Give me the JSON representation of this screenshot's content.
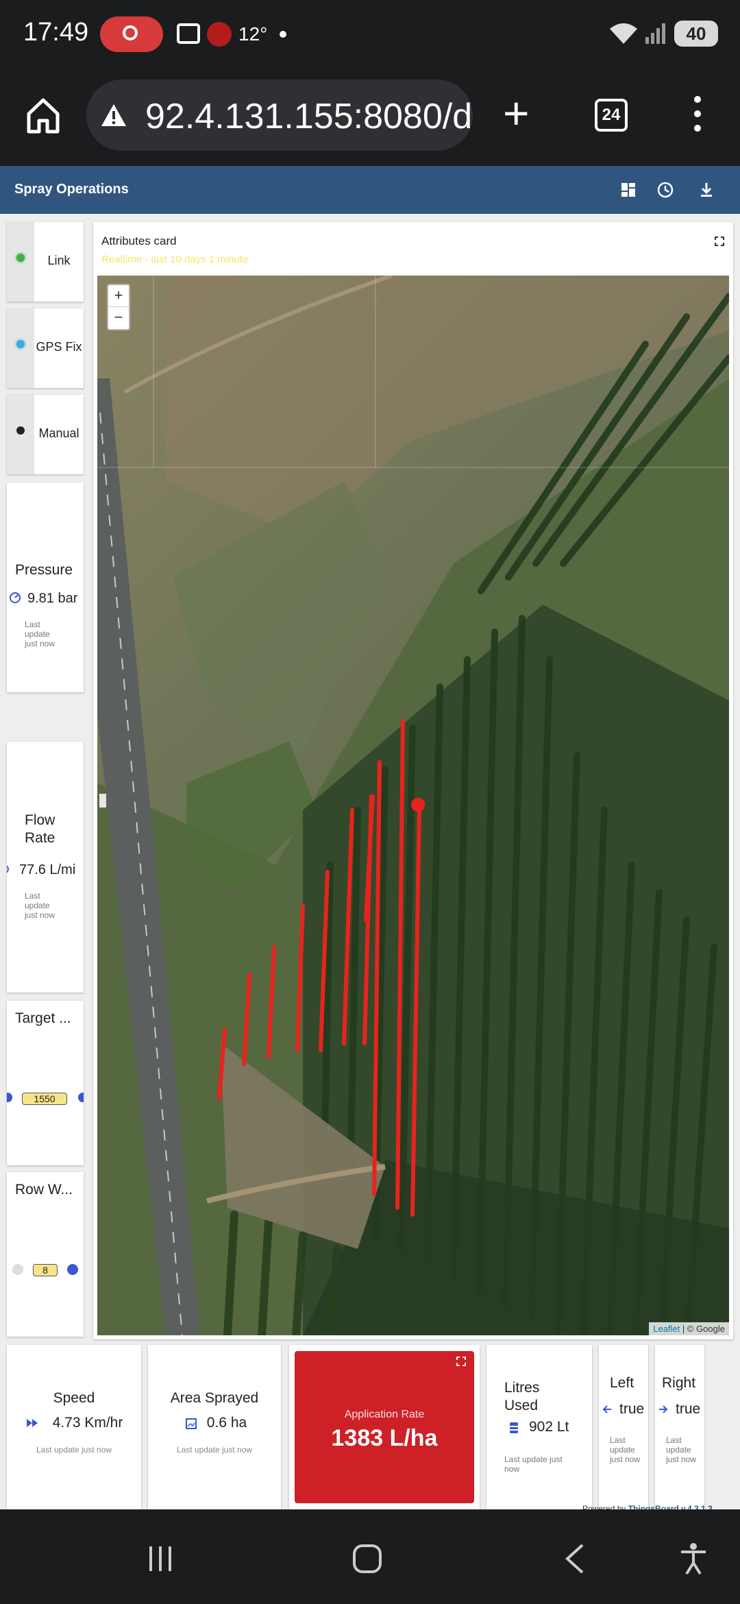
{
  "status_bar": {
    "time": "17:49",
    "temperature": "12°",
    "battery": "40",
    "icons": [
      "screen-record-icon",
      "camera-icon",
      "app-notification-icon",
      "wifi-icon",
      "signal-icon",
      "battery-icon"
    ]
  },
  "browser": {
    "url": "92.4.131.155:8080/d",
    "tab_count": "24",
    "icons": [
      "home-icon",
      "warning-icon",
      "new-tab-icon",
      "tabs-icon",
      "more-icon"
    ]
  },
  "dashboard": {
    "title": "Spray Operations",
    "toolbar_icons": [
      "layout-icon",
      "history-icon",
      "download-icon"
    ]
  },
  "indicators": [
    {
      "label": "Link",
      "led_color": "#3fb14a"
    },
    {
      "label": "GPS Fix",
      "led_color": "#3fa9df"
    },
    {
      "label": "Manual",
      "led_color": "#222222"
    }
  ],
  "pressure": {
    "title": "Pressure",
    "value": "9.81 bar",
    "update": "Last update just now"
  },
  "flow_rate": {
    "title": "Flow Rate",
    "value": "77.6 L/mi",
    "update": "Last update just now"
  },
  "target": {
    "title": "Target ...",
    "value": "1550"
  },
  "row_width": {
    "title": "Row W...",
    "value": "8"
  },
  "map_card": {
    "title": "Attributes card",
    "realtime": "Realtime - last 10 days 1 minute",
    "zoom_in": "+",
    "zoom_out": "−",
    "attribution_link": "Leaflet",
    "attribution_rest": " | © Google"
  },
  "speed": {
    "title": "Speed",
    "value": "4.73 Km/hr",
    "update": "Last update just now"
  },
  "area": {
    "title": "Area Sprayed",
    "value": "0.6 ha",
    "update": "Last update just now"
  },
  "application_rate": {
    "title": "Application Rate",
    "value": "1383 L/ha",
    "color": "#cd2027"
  },
  "litres": {
    "title": "Litres Used",
    "value": "902 Lt",
    "update": "Last update just now"
  },
  "left": {
    "title": "Left",
    "value": "true",
    "update": "Last update just now"
  },
  "right": {
    "title": "Right",
    "value": "true",
    "update": "Last update just now"
  },
  "powered_by": {
    "prefix": "Powered by ",
    "brand": "ThingsBoard v.4.3.1.3"
  },
  "colors": {
    "header": "#305680",
    "spray_track": "#e8231e",
    "accent_blue": "#3b55d6"
  }
}
